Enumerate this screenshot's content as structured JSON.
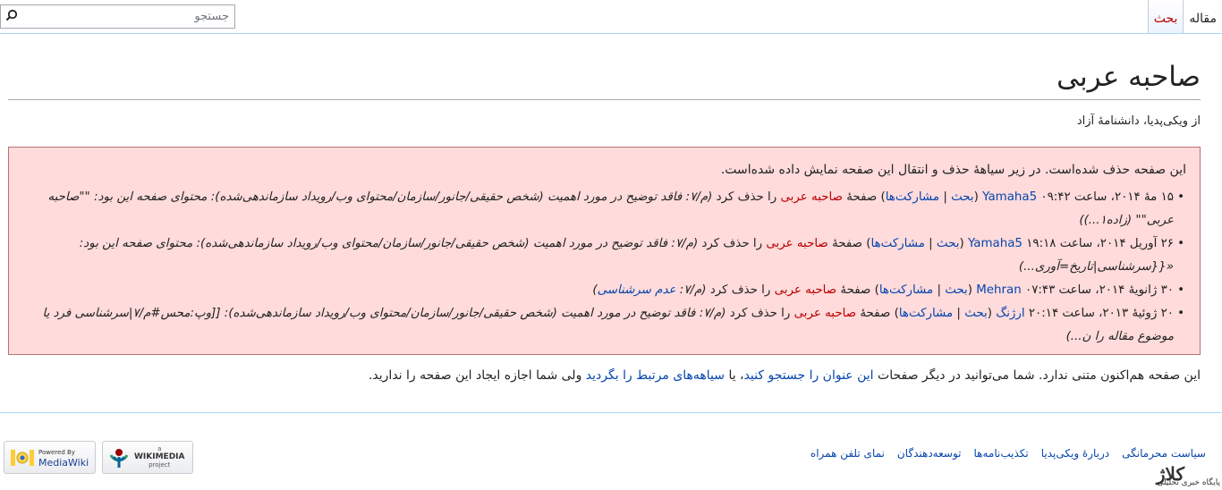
{
  "header": {
    "tabs": [
      {
        "label": "مقاله",
        "selected": true
      },
      {
        "label": "بحث",
        "selected": false
      }
    ],
    "search": {
      "placeholder": "جستجو"
    }
  },
  "page": {
    "title": "صاحبه عربی",
    "subtitle": "از ویکی‌پدیا، دانشنامهٔ آزاد"
  },
  "deletion_log": {
    "intro": "این صفحه حذف شده‌است. در زیر سیاههٔ حذف و انتقال این صفحه نمایش داده شده‌است.",
    "entries": [
      {
        "date": "۱۵ مهٔ ۲۰۱۴، ساعت ۰۹:۴۲",
        "user": "Yamaha5",
        "talk": "بحث",
        "sep": "|",
        "contribs": "مشارکت‌ها",
        "action_pre": "صفحهٔ",
        "page": "صاحبه عربی",
        "action_post": "را حذف کرد",
        "comment": "(م‌‌/‌‌۷: فاقد توضیح در مورد اهمیت (شخص حقیقی/جانور/سازمان/محتوای وب/رویداد سازماندهی‌شده): محتوای صفحه این بود: \"\"صاحبه عربی\"\" (زاده۱...))"
      },
      {
        "date": "۲۶ آوریل ۲۰۱۴، ساعت ۱۹:۱۸",
        "user": "Yamaha5",
        "talk": "بحث",
        "sep": "|",
        "contribs": "مشارکت‌ها",
        "action_pre": "صفحهٔ",
        "page": "صاحبه عربی",
        "action_post": "را حذف کرد",
        "comment": "(م‌‌/‌‌۷: فاقد توضیح در مورد اهمیت (شخص حقیقی/جانور/سازمان/محتوای وب/رویداد سازماندهی‌شده): محتوای صفحه این بود: «{{سرشناسی|تاریخ=آوری...)"
      },
      {
        "date": "۳۰ ژانویهٔ ۲۰۱۴، ساعت ۰۷:۴۳",
        "user": "Mehran",
        "talk": "بحث",
        "sep": "|",
        "contribs": "مشارکت‌ها",
        "action_pre": "صفحهٔ",
        "page": "صاحبه عربی",
        "action_post": "را حذف کرد",
        "comment_pre": "(م‌‌/‌‌۷: ",
        "comment_link": "عدم سرشناسی",
        "comment_post": ")"
      },
      {
        "date": "۲۰ ژوئیهٔ ۲۰۱۳، ساعت ۲۰:۱۴",
        "user": "ارژنگ",
        "talk": "بحث",
        "sep": "|",
        "contribs": "مشارکت‌ها",
        "action_pre": "صفحهٔ",
        "page": "صاحبه عربی",
        "action_post": "را حذف کرد",
        "comment": "(م‌‌/‌‌۷: فاقد توضیح در مورد اهمیت (شخص حقیقی/جانور/سازمان/محتوای وب/رویداد سازماندهی‌شده): [[وپ:محس#م‌/۷|سرشناسی فرد یا موضوع مقاله را ن...)"
      }
    ]
  },
  "no_article": {
    "text_1": "این صفحه هم‌اکنون متنی ندارد. شما می‌توانید در دیگر صفحات",
    "link_search": "این عنوان را جستجو کنید",
    "text_2": "، یا",
    "link_logs": "سیاهه‌های مرتبط را بگردید",
    "text_3": "ولی شما اجازه ایجاد این صفحه را ندارید."
  },
  "footer": {
    "links": [
      "سیاست محرمانگی",
      "دربارهٔ ویکی‌پدیا",
      "تکذیب‌نامه‌ها",
      "توسعه‌دهندگان",
      "نمای تلفن همراه"
    ],
    "badge_wikimedia": {
      "small": "a",
      "name": "WIKIMEDIA",
      "sub": "project"
    },
    "badge_mediawiki": {
      "top": "Powered By",
      "name": "MediaWiki"
    }
  },
  "watermark": {
    "logo_text": "کلاژ",
    "text": "پایگاه خبری تحلیلی"
  }
}
